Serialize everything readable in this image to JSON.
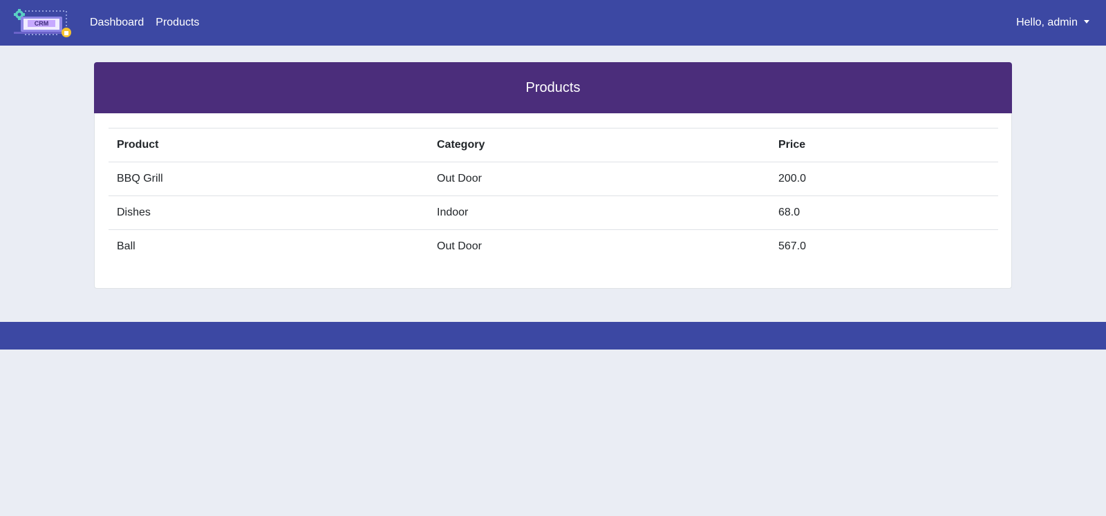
{
  "nav": {
    "logo_text": "CRM",
    "links": [
      "Dashboard",
      "Products"
    ],
    "user_greeting": "Hello, admin"
  },
  "page": {
    "title": "Products"
  },
  "table": {
    "headers": [
      "Product",
      "Category",
      "Price"
    ],
    "rows": [
      [
        "BBQ Grill",
        "Out Door",
        "200.0"
      ],
      [
        "Dishes",
        "Indoor",
        "68.0"
      ],
      [
        "Ball",
        "Out Door",
        "567.0"
      ]
    ]
  },
  "colors": {
    "navbar": "#3c48a3",
    "card_header": "#4b2d7b",
    "background": "#eaedf4"
  }
}
